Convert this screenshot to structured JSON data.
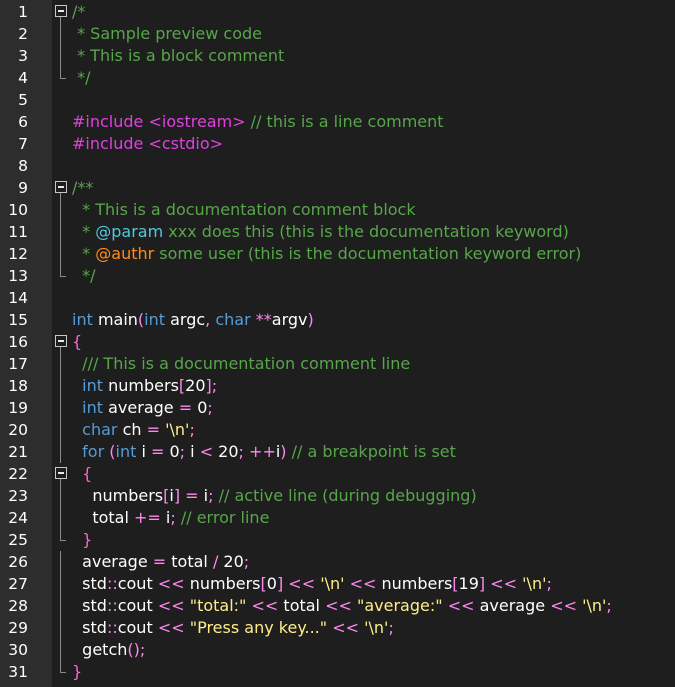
{
  "editor": {
    "colors": {
      "background": "#1e1e1e",
      "gutter": "#2d2d2d",
      "comment": "#57a64a",
      "preprocessor": "#e040e0",
      "keyword": "#569cd6",
      "operator": "#ff88ee",
      "string": "#ffee88",
      "doc_keyword": "#4ec9e0",
      "doc_keyword_error": "#ff8c1a"
    },
    "lines": [
      {
        "n": "1",
        "fold": "start",
        "tokens": [
          [
            "comment",
            "/*"
          ]
        ]
      },
      {
        "n": "2",
        "fold": "mid",
        "tokens": [
          [
            "comment",
            " * Sample preview code"
          ]
        ]
      },
      {
        "n": "3",
        "fold": "mid",
        "tokens": [
          [
            "comment",
            " * This is a block comment"
          ]
        ]
      },
      {
        "n": "4",
        "fold": "end",
        "tokens": [
          [
            "comment",
            " */"
          ]
        ]
      },
      {
        "n": "5",
        "fold": "",
        "tokens": []
      },
      {
        "n": "6",
        "fold": "",
        "tokens": [
          [
            "prep",
            "#include <iostream>"
          ],
          [
            "ident",
            " "
          ],
          [
            "comment",
            "// this is a line comment"
          ]
        ]
      },
      {
        "n": "7",
        "fold": "",
        "tokens": [
          [
            "prep",
            "#include <cstdio>"
          ]
        ]
      },
      {
        "n": "8",
        "fold": "",
        "tokens": []
      },
      {
        "n": "9",
        "fold": "start",
        "tokens": [
          [
            "comment",
            "/**"
          ]
        ]
      },
      {
        "n": "10",
        "fold": "mid",
        "tokens": [
          [
            "comment",
            "  * This is a documentation comment block"
          ]
        ]
      },
      {
        "n": "11",
        "fold": "mid",
        "tokens": [
          [
            "comment",
            "  * "
          ],
          [
            "doc-kw",
            "@param"
          ],
          [
            "comment",
            " xxx does this (this is the documentation keyword)"
          ]
        ]
      },
      {
        "n": "12",
        "fold": "mid",
        "tokens": [
          [
            "comment",
            "  * "
          ],
          [
            "doc-err",
            "@authr"
          ],
          [
            "comment",
            " some user (this is the documentation keyword error)"
          ]
        ]
      },
      {
        "n": "13",
        "fold": "end",
        "tokens": [
          [
            "comment",
            "  */"
          ]
        ]
      },
      {
        "n": "14",
        "fold": "",
        "tokens": []
      },
      {
        "n": "15",
        "fold": "",
        "tokens": [
          [
            "kw",
            "int"
          ],
          [
            "ident",
            " main"
          ],
          [
            "op",
            "("
          ],
          [
            "kw",
            "int"
          ],
          [
            "ident",
            " argc"
          ],
          [
            "op",
            ","
          ],
          [
            "ident",
            " "
          ],
          [
            "kw",
            "char"
          ],
          [
            "ident",
            " "
          ],
          [
            "op",
            "**"
          ],
          [
            "ident",
            "argv"
          ],
          [
            "op",
            ")"
          ]
        ]
      },
      {
        "n": "16",
        "fold": "start",
        "tokens": [
          [
            "brace",
            "{"
          ]
        ]
      },
      {
        "n": "17",
        "fold": "mid",
        "tokens": [
          [
            "ident",
            "  "
          ],
          [
            "comment",
            "/// This is a documentation comment line"
          ]
        ]
      },
      {
        "n": "18",
        "fold": "mid",
        "tokens": [
          [
            "ident",
            "  "
          ],
          [
            "kw",
            "int"
          ],
          [
            "ident",
            " numbers"
          ],
          [
            "op",
            "["
          ],
          [
            "num",
            "20"
          ],
          [
            "op",
            "];"
          ]
        ]
      },
      {
        "n": "19",
        "fold": "mid",
        "tokens": [
          [
            "ident",
            "  "
          ],
          [
            "kw",
            "int"
          ],
          [
            "ident",
            " average "
          ],
          [
            "op",
            "="
          ],
          [
            "num",
            " 0"
          ],
          [
            "op",
            ";"
          ]
        ]
      },
      {
        "n": "20",
        "fold": "mid",
        "tokens": [
          [
            "ident",
            "  "
          ],
          [
            "kw",
            "char"
          ],
          [
            "ident",
            " ch "
          ],
          [
            "op",
            "="
          ],
          [
            "ident",
            " "
          ],
          [
            "str",
            "'\\n'"
          ],
          [
            "op",
            ";"
          ]
        ]
      },
      {
        "n": "21",
        "fold": "mid",
        "tokens": [
          [
            "ident",
            "  "
          ],
          [
            "kw",
            "for"
          ],
          [
            "ident",
            " "
          ],
          [
            "op",
            "("
          ],
          [
            "kw",
            "int"
          ],
          [
            "ident",
            " i "
          ],
          [
            "op",
            "="
          ],
          [
            "num",
            " 0"
          ],
          [
            "op",
            ";"
          ],
          [
            "ident",
            " i "
          ],
          [
            "op",
            "<"
          ],
          [
            "num",
            " 20"
          ],
          [
            "op",
            ";"
          ],
          [
            "ident",
            " "
          ],
          [
            "op",
            "++"
          ],
          [
            "ident",
            "i"
          ],
          [
            "op",
            ")"
          ],
          [
            "ident",
            " "
          ],
          [
            "comment",
            "// a breakpoint is set"
          ]
        ]
      },
      {
        "n": "22",
        "fold": "start",
        "tokens": [
          [
            "ident",
            "  "
          ],
          [
            "brace",
            "{"
          ]
        ]
      },
      {
        "n": "23",
        "fold": "mid",
        "tokens": [
          [
            "ident",
            "    numbers"
          ],
          [
            "op",
            "["
          ],
          [
            "ident",
            "i"
          ],
          [
            "op",
            "]"
          ],
          [
            "ident",
            " "
          ],
          [
            "op",
            "="
          ],
          [
            "ident",
            " i"
          ],
          [
            "op",
            ";"
          ],
          [
            "ident",
            " "
          ],
          [
            "comment",
            "// active line (during debugging)"
          ]
        ]
      },
      {
        "n": "24",
        "fold": "mid",
        "tokens": [
          [
            "ident",
            "    total "
          ],
          [
            "op",
            "+="
          ],
          [
            "ident",
            " i"
          ],
          [
            "op",
            ";"
          ],
          [
            "ident",
            " "
          ],
          [
            "comment",
            "// error line"
          ]
        ]
      },
      {
        "n": "25",
        "fold": "end",
        "tokens": [
          [
            "ident",
            "  "
          ],
          [
            "brace",
            "}"
          ]
        ]
      },
      {
        "n": "26",
        "fold": "mid",
        "tokens": [
          [
            "ident",
            "  average "
          ],
          [
            "op",
            "="
          ],
          [
            "ident",
            " total "
          ],
          [
            "op",
            "/"
          ],
          [
            "num",
            " 20"
          ],
          [
            "op",
            ";"
          ]
        ]
      },
      {
        "n": "27",
        "fold": "mid",
        "tokens": [
          [
            "ident",
            "  std"
          ],
          [
            "op",
            "::"
          ],
          [
            "ident",
            "cout "
          ],
          [
            "op",
            "<<"
          ],
          [
            "ident",
            " numbers"
          ],
          [
            "op",
            "["
          ],
          [
            "num",
            "0"
          ],
          [
            "op",
            "]"
          ],
          [
            "ident",
            " "
          ],
          [
            "op",
            "<<"
          ],
          [
            "ident",
            " "
          ],
          [
            "str",
            "'\\n'"
          ],
          [
            "ident",
            " "
          ],
          [
            "op",
            "<<"
          ],
          [
            "ident",
            " numbers"
          ],
          [
            "op",
            "["
          ],
          [
            "num",
            "19"
          ],
          [
            "op",
            "]"
          ],
          [
            "ident",
            " "
          ],
          [
            "op",
            "<<"
          ],
          [
            "ident",
            " "
          ],
          [
            "str",
            "'\\n'"
          ],
          [
            "op",
            ";"
          ]
        ]
      },
      {
        "n": "28",
        "fold": "mid",
        "tokens": [
          [
            "ident",
            "  std"
          ],
          [
            "op",
            "::"
          ],
          [
            "ident",
            "cout "
          ],
          [
            "op",
            "<<"
          ],
          [
            "ident",
            " "
          ],
          [
            "str",
            "\"total:\""
          ],
          [
            "ident",
            " "
          ],
          [
            "op",
            "<<"
          ],
          [
            "ident",
            " total "
          ],
          [
            "op",
            "<<"
          ],
          [
            "ident",
            " "
          ],
          [
            "str",
            "\"average:\""
          ],
          [
            "ident",
            " "
          ],
          [
            "op",
            "<<"
          ],
          [
            "ident",
            " average "
          ],
          [
            "op",
            "<<"
          ],
          [
            "ident",
            " "
          ],
          [
            "str",
            "'\\n'"
          ],
          [
            "op",
            ";"
          ]
        ]
      },
      {
        "n": "29",
        "fold": "mid",
        "tokens": [
          [
            "ident",
            "  std"
          ],
          [
            "op",
            "::"
          ],
          [
            "ident",
            "cout "
          ],
          [
            "op",
            "<<"
          ],
          [
            "ident",
            " "
          ],
          [
            "str",
            "\"Press any key...\""
          ],
          [
            "ident",
            " "
          ],
          [
            "op",
            "<<"
          ],
          [
            "ident",
            " "
          ],
          [
            "str",
            "'\\n'"
          ],
          [
            "op",
            ";"
          ]
        ]
      },
      {
        "n": "30",
        "fold": "mid",
        "tokens": [
          [
            "ident",
            "  getch"
          ],
          [
            "op",
            "();"
          ]
        ]
      },
      {
        "n": "31",
        "fold": "end",
        "tokens": [
          [
            "brace",
            "}"
          ]
        ]
      }
    ]
  }
}
